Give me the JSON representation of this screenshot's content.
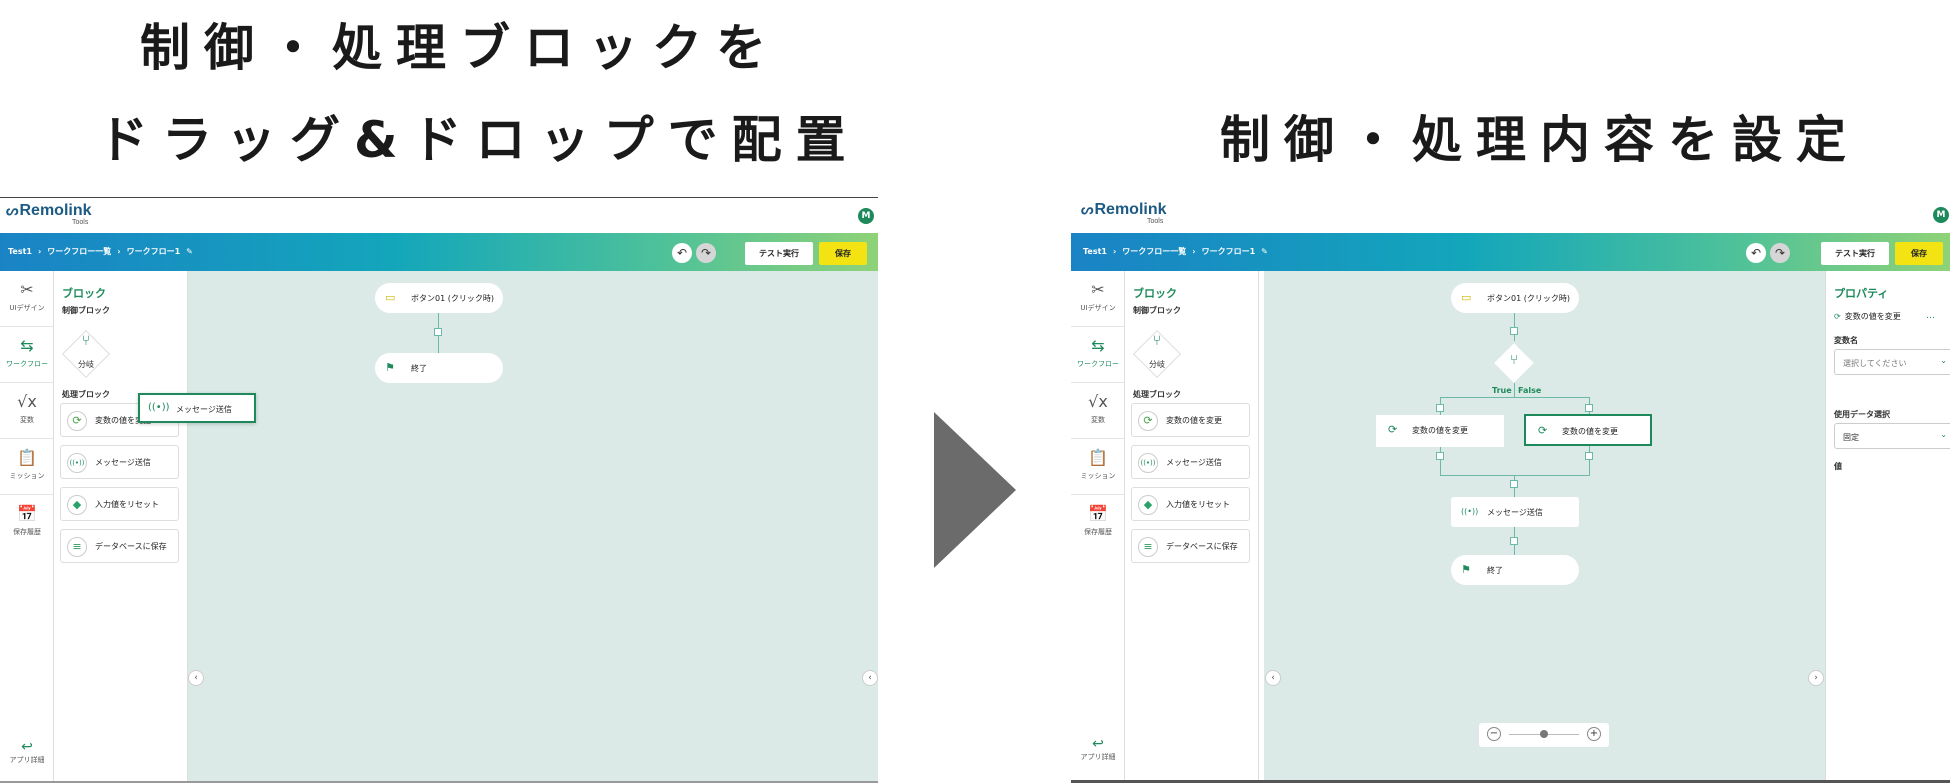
{
  "headings": {
    "left_line1": "制御・処理ブロックを",
    "left_line2": "ドラッグ&ドロップで配置",
    "right": "制御・処理内容を設定"
  },
  "app": {
    "logo": "Remolink",
    "logo_sub": "Tools",
    "avatar": "M",
    "breadcrumb": [
      "Test1",
      "›",
      "ワークフロー一覧",
      "›",
      "ワークフロー1",
      "✎"
    ],
    "undo_icon": "undo-icon",
    "redo_icon": "redo-icon",
    "test_button": "テスト実行",
    "save_button": "保存"
  },
  "nav": {
    "items": [
      {
        "icon": "ui-design-icon",
        "glyph": "✂",
        "label": "UIデザイン",
        "active": false
      },
      {
        "icon": "workflow-icon",
        "glyph": "⇆",
        "label": "ワークフロー",
        "active": true
      },
      {
        "icon": "variable-icon",
        "glyph": "√x",
        "label": "変数",
        "active": false
      },
      {
        "icon": "mission-icon",
        "glyph": "📋",
        "label": "ミッション",
        "active": false
      },
      {
        "icon": "history-icon",
        "glyph": "📅",
        "label": "保存履歴",
        "active": false
      }
    ],
    "back_label": "アプリ詳細"
  },
  "palette": {
    "title": "ブロック",
    "control_label": "制御ブロック",
    "branch_label": "分岐",
    "process_label": "処理ブロック",
    "blocks": [
      {
        "icon": "refresh-icon",
        "glyph": "⟳",
        "label": "変数の値を変更",
        "color": "#4aa34a"
      },
      {
        "icon": "broadcast-icon",
        "glyph": "((•))",
        "label": "メッセージ送信",
        "color": "#1e8a5c"
      },
      {
        "icon": "eraser-icon",
        "glyph": "◆",
        "label": "入力値をリセット",
        "color": "#2aa36a"
      },
      {
        "icon": "database-icon",
        "glyph": "≡",
        "label": "データベースに保存",
        "color": "#2e9a5a"
      }
    ]
  },
  "left_canvas": {
    "trigger_node": "ボタン01 (クリック時)",
    "end_node": "終了",
    "dragging_block": "メッセージ送信"
  },
  "right_canvas": {
    "trigger_node": "ボタン01 (クリック時)",
    "true_label": "True",
    "false_label": "False",
    "true_branch_block": "変数の値を変更",
    "false_branch_block": "変数の値を変更",
    "message_node": "メッセージ送信",
    "end_node": "終了",
    "zoom_minus": "−",
    "zoom_plus": "+",
    "zoom_level": 0.5
  },
  "properties": {
    "title": "プロパティ",
    "block_name": "変数の値を変更",
    "more": "…",
    "variable_label": "変数名",
    "variable_placeholder": "選択してください",
    "data_select_label": "使用データ選択",
    "data_select_value": "固定",
    "value_label": "値"
  }
}
